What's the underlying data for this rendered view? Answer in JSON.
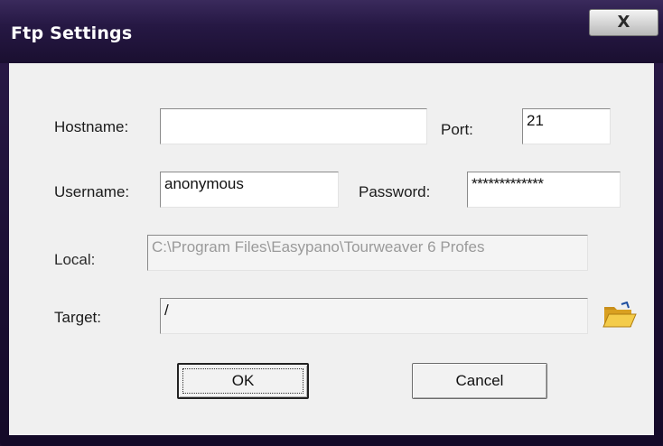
{
  "window": {
    "title": "Ftp Settings",
    "close_label": "X"
  },
  "form": {
    "hostname_label": "Hostname:",
    "hostname_value": "",
    "port_label": "Port:",
    "port_value": "21",
    "username_label": "Username:",
    "username_value": "anonymous",
    "password_label": "Password:",
    "password_value": "*************",
    "local_label": "Local:",
    "local_value": "C:\\Program Files\\Easypano\\Tourweaver 6 Profes",
    "target_label": "Target:",
    "target_value": "/"
  },
  "buttons": {
    "ok_label": "OK",
    "cancel_label": "Cancel"
  },
  "icons": {
    "browse": "open-folder-icon",
    "close": "close-icon"
  },
  "colors": {
    "titlebar": "#261844",
    "client": "#f0f0f0",
    "folder": "#e8b430"
  }
}
